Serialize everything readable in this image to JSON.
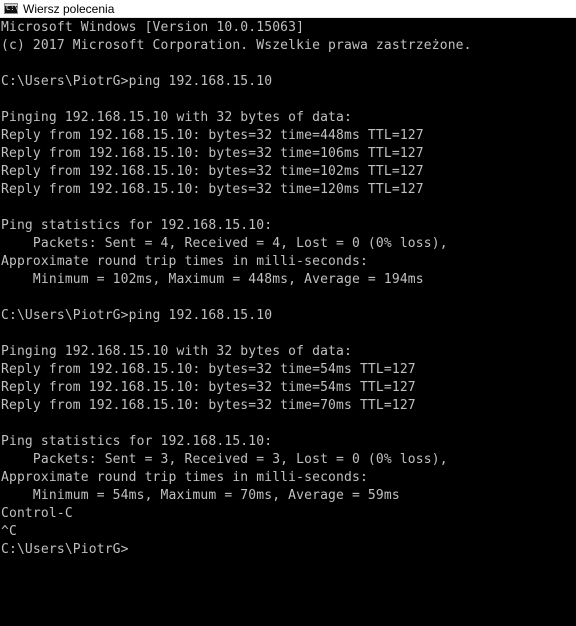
{
  "window": {
    "title": "Wiersz polecenia",
    "icon": "cmd-icon",
    "background": "#000000",
    "text_color": "#c0c0c0"
  },
  "console": {
    "lines": [
      "Microsoft Windows [Version 10.0.15063]",
      "(c) 2017 Microsoft Corporation. Wszelkie prawa zastrzeżone.",
      "",
      "C:\\Users\\PiotrG>ping 192.168.15.10",
      "",
      "Pinging 192.168.15.10 with 32 bytes of data:",
      "Reply from 192.168.15.10: bytes=32 time=448ms TTL=127",
      "Reply from 192.168.15.10: bytes=32 time=106ms TTL=127",
      "Reply from 192.168.15.10: bytes=32 time=102ms TTL=127",
      "Reply from 192.168.15.10: bytes=32 time=120ms TTL=127",
      "",
      "Ping statistics for 192.168.15.10:",
      "    Packets: Sent = 4, Received = 4, Lost = 0 (0% loss),",
      "Approximate round trip times in milli-seconds:",
      "    Minimum = 102ms, Maximum = 448ms, Average = 194ms",
      "",
      "C:\\Users\\PiotrG>ping 192.168.15.10",
      "",
      "Pinging 192.168.15.10 with 32 bytes of data:",
      "Reply from 192.168.15.10: bytes=32 time=54ms TTL=127",
      "Reply from 192.168.15.10: bytes=32 time=54ms TTL=127",
      "Reply from 192.168.15.10: bytes=32 time=70ms TTL=127",
      "",
      "Ping statistics for 192.168.15.10:",
      "    Packets: Sent = 3, Received = 3, Lost = 0 (0% loss),",
      "Approximate round trip times in milli-seconds:",
      "    Minimum = 54ms, Maximum = 70ms, Average = 59ms",
      "Control-C",
      "^C",
      "C:\\Users\\PiotrG>"
    ]
  }
}
